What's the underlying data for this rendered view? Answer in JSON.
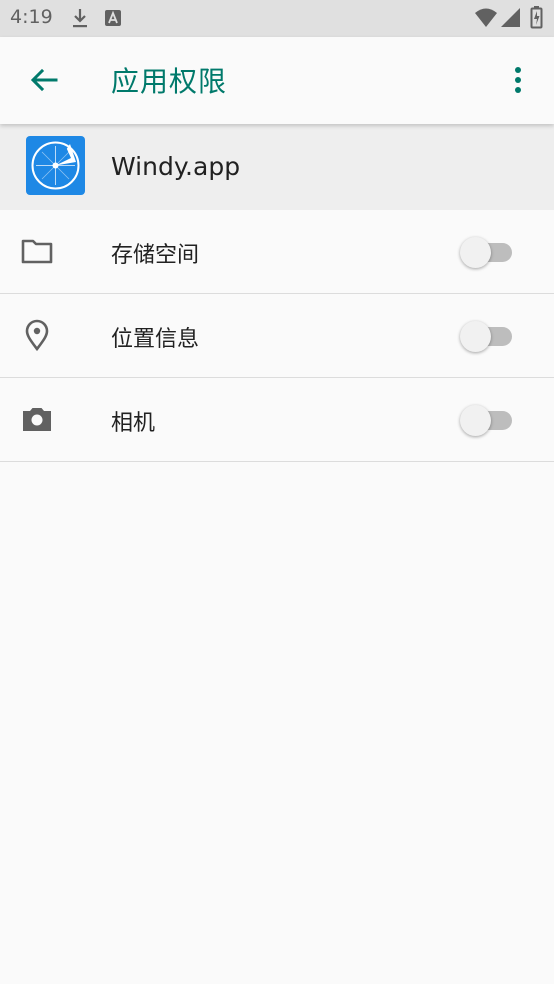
{
  "status_bar": {
    "time": "4:19",
    "icons": [
      "download-icon",
      "a-notification-icon",
      "wifi-icon",
      "signal-icon",
      "battery-icon"
    ]
  },
  "app_bar": {
    "title": "应用权限",
    "back_icon": "arrow-back-icon",
    "more_icon": "more-vert-icon",
    "accent_color": "#00796b"
  },
  "app": {
    "name": "Windy.app",
    "icon": "windy-app-icon",
    "icon_color": "#1e88e5"
  },
  "permissions": [
    {
      "label": "存储空间",
      "icon": "folder-icon",
      "enabled": false
    },
    {
      "label": "位置信息",
      "icon": "location-pin-icon",
      "enabled": false
    },
    {
      "label": "相机",
      "icon": "camera-icon",
      "enabled": false
    }
  ]
}
